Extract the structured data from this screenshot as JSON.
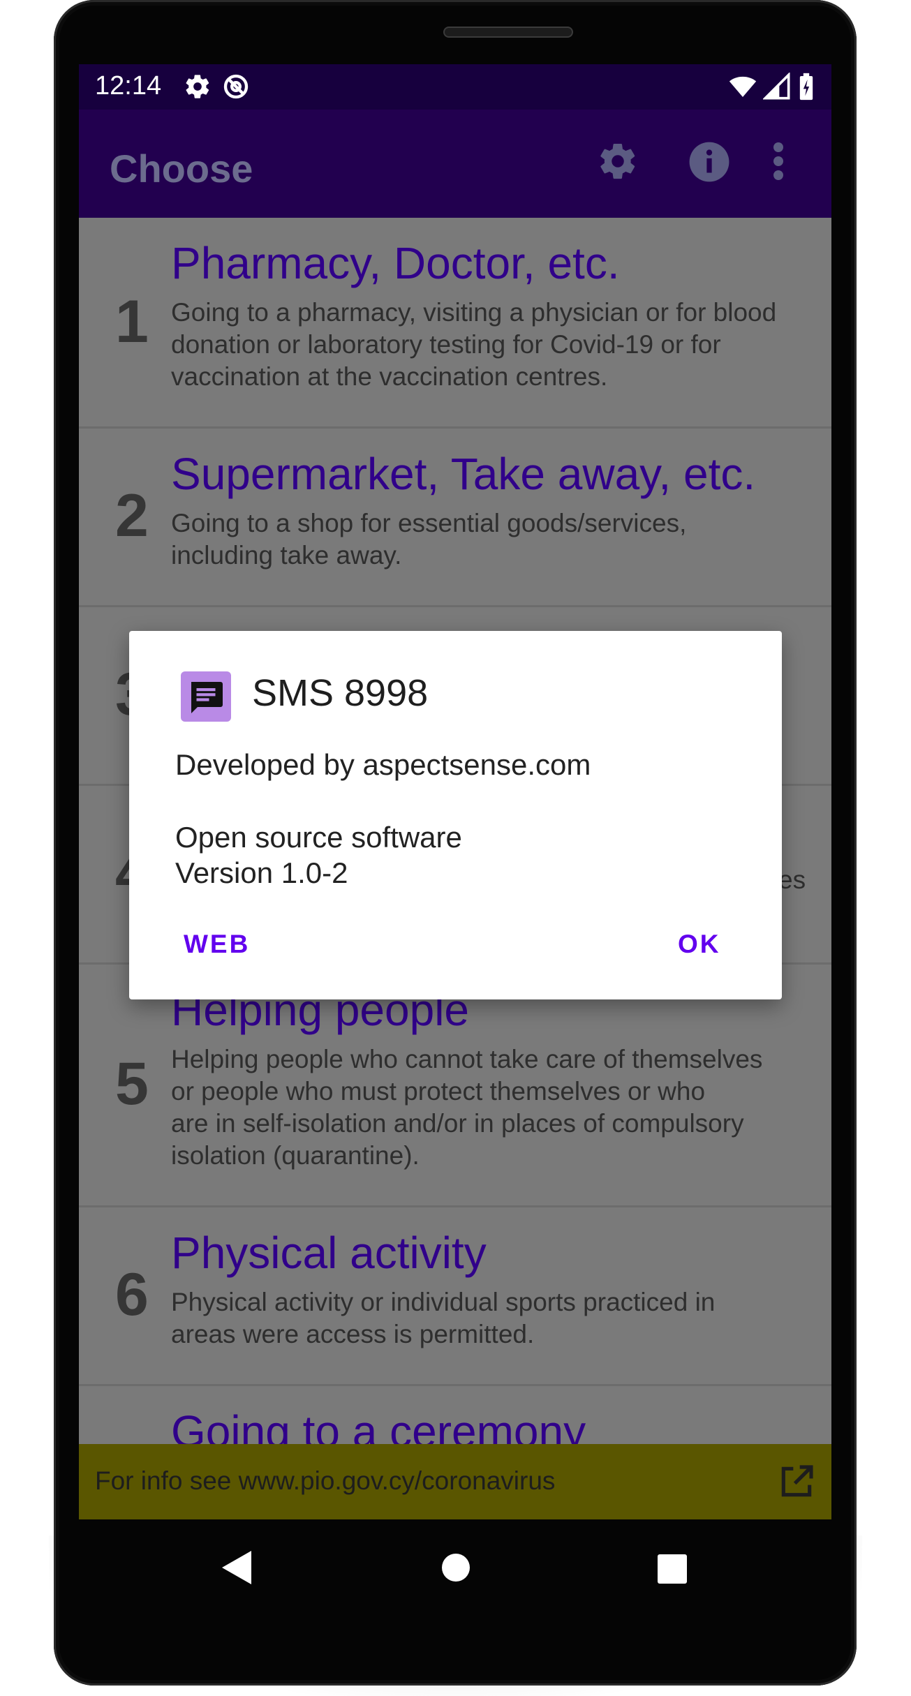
{
  "status_bar": {
    "time": "12:14",
    "left_icons": [
      "settings-icon",
      "sync-icon"
    ],
    "right_icons": [
      "wifi-icon",
      "signal-icon",
      "battery-icon"
    ]
  },
  "app_bar": {
    "title": "Choose",
    "actions": [
      "settings-icon",
      "info-icon",
      "more-vert-icon"
    ]
  },
  "list": {
    "items": [
      {
        "number": "1",
        "title": "Pharmacy, Doctor, etc.",
        "description": [
          "Going to a pharmacy, visiting a physician or for blood",
          "donation or laboratory testing for Covid-19 or for",
          "vaccination at the vaccination centres."
        ]
      },
      {
        "number": "2",
        "title": "Supermarket, Take away, etc.",
        "description": [
          "Going to a shop for essential goods/services,",
          "including take away."
        ]
      },
      {
        "number": "3",
        "title": "",
        "description": []
      },
      {
        "number": "4",
        "title": "",
        "description": [
          "es"
        ]
      },
      {
        "number": "5",
        "title": "Helping people",
        "description": [
          "Helping people who cannot take care of themselves",
          "or people who must protect themselves or who",
          "are in self-isolation and/or in places of compulsory",
          "isolation (quarantine)."
        ]
      },
      {
        "number": "6",
        "title": "Physical activity",
        "description": [
          "Physical activity or individual sports practiced in",
          "areas were access is permitted."
        ]
      },
      {
        "number": "",
        "title": "Going to a ceremony",
        "description": []
      }
    ]
  },
  "info_bar": {
    "text": "For info see www.pio.gov.cy/coronavirus",
    "icon": "open-in-new-icon"
  },
  "dialog": {
    "title": "SMS 8998",
    "icon": "message-icon",
    "developer": "Developed by aspectsense.com",
    "license": "Open source software",
    "version": "Version 1.0-2",
    "web_button": "WEB",
    "ok_button": "OK"
  },
  "nav_bar": [
    "back-icon",
    "home-icon",
    "recents-icon"
  ],
  "colors": {
    "status_bar": "#17003e",
    "app_bar": "#22004f",
    "item_title": "#30008a",
    "info_bar": "#5a5600",
    "dialog_accent": "#6200ee",
    "dialog_icon_bg": "#b98ae6"
  }
}
